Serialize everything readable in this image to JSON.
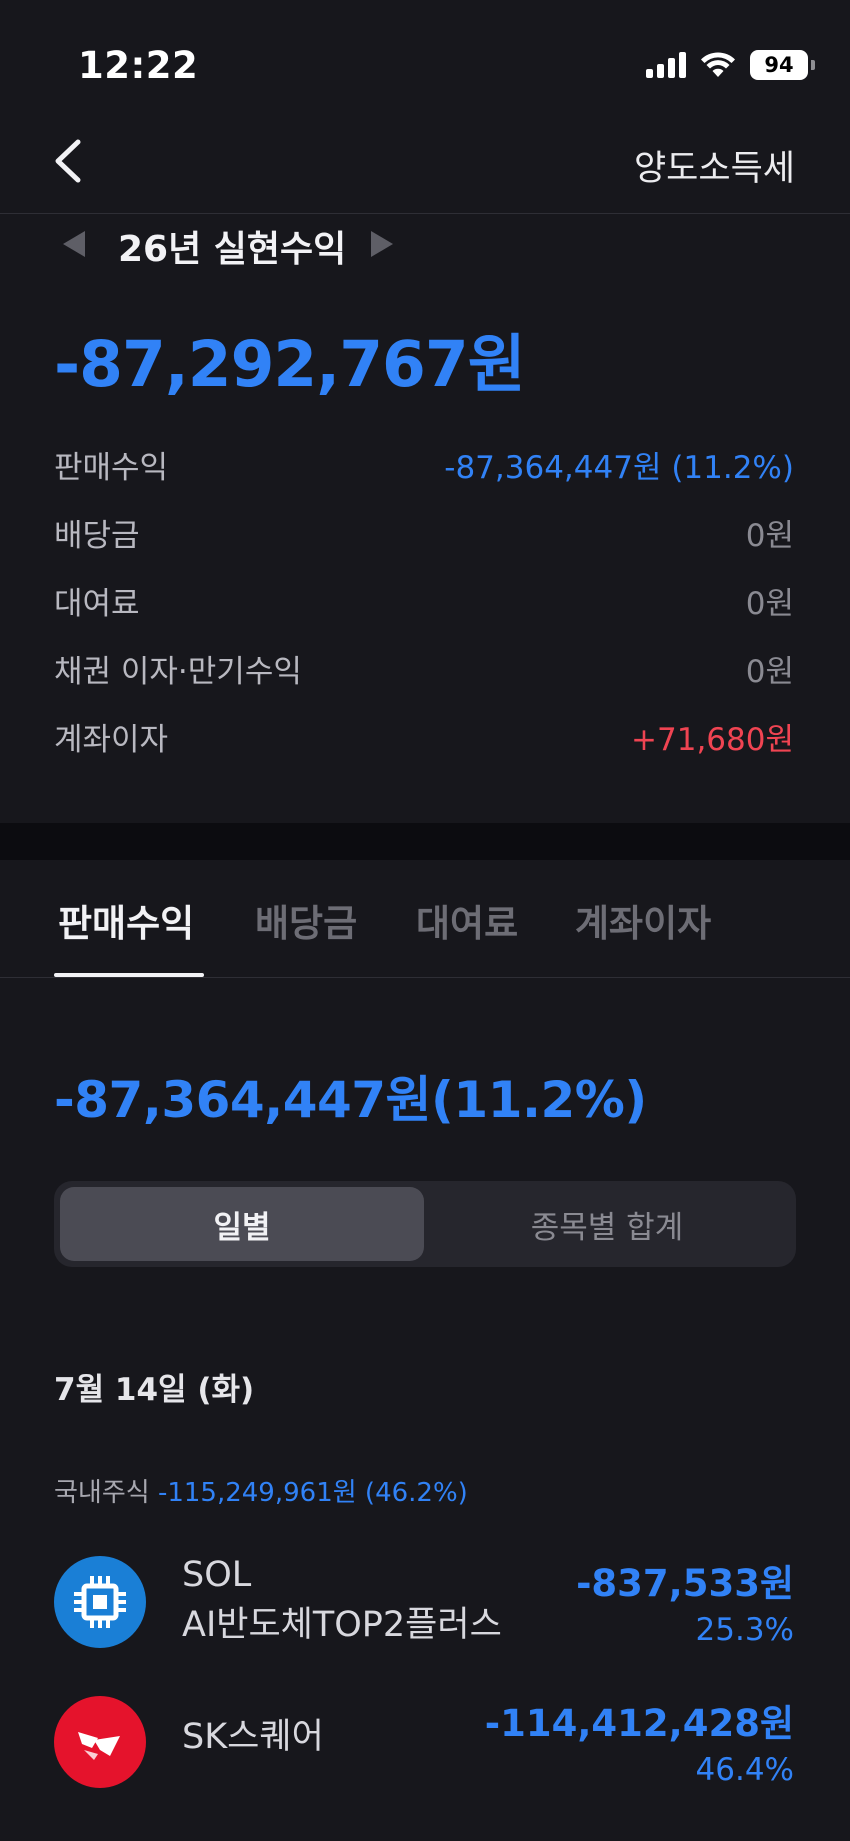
{
  "status_bar": {
    "time": "12:22",
    "battery": "94"
  },
  "nav": {
    "title": "양도소득세"
  },
  "summary": {
    "period_label": "26년 실현수익",
    "total": "-87,292,767원",
    "rows": [
      {
        "label": "판매수익",
        "value": "-87,364,447원 (11.2%)",
        "tone": "blue"
      },
      {
        "label": "배당금",
        "value": "0원",
        "tone": "gray"
      },
      {
        "label": "대여료",
        "value": "0원",
        "tone": "gray"
      },
      {
        "label": "채권 이자·만기수익",
        "value": "0원",
        "tone": "gray"
      },
      {
        "label": "계좌이자",
        "value": "+71,680원",
        "tone": "red"
      }
    ]
  },
  "tabs": [
    {
      "label": "판매수익",
      "active": true
    },
    {
      "label": "배당금",
      "active": false
    },
    {
      "label": "대여료",
      "active": false
    },
    {
      "label": "계좌이자",
      "active": false
    }
  ],
  "sales": {
    "total": "-87,364,447원(11.2%)",
    "segments": {
      "daily": "일별",
      "by_stock": "종목별 합계"
    },
    "date_header": "7월 14일 (화)",
    "domestic_label": "국내주식",
    "domestic_value": "-115,249,961원 (46.2%)",
    "stocks": [
      {
        "name_line1": "SOL",
        "name_line2": "AI반도체TOP2플러스",
        "amount": "-837,533원",
        "pct": "25.3%",
        "icon": "chip-icon",
        "color": "#1a7fd6"
      },
      {
        "name_line1": "SK스퀘어",
        "amount": "-114,412,428원",
        "pct": "46.4%",
        "icon": "sk-logo-icon",
        "color": "#e5132c"
      }
    ]
  },
  "colors": {
    "accent_blue": "#3182f6",
    "positive_red": "#f04452",
    "background": "#17171c"
  }
}
